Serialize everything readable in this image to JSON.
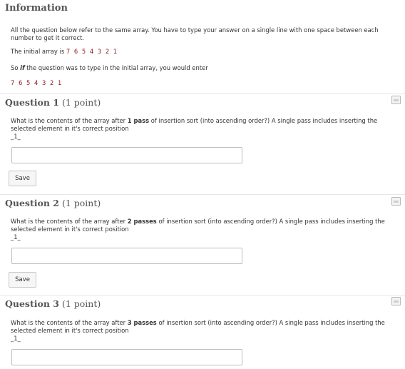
{
  "info": {
    "title": "Information",
    "line1": "All the question below refer to the same array.  You have to type your answer on a single line with one space between each number to get it correct.",
    "initial_prefix": "The initial array is ",
    "initial_array": "7 6 5 4 3 2 1",
    "so_prefix": "So ",
    "so_if": "if",
    "so_suffix": " the question was to type in the initial array, you would enter",
    "example_answer": "7 6 5 4 3 2 1"
  },
  "questions": [
    {
      "label": "Question 1",
      "points": "(1 point)",
      "text_before": "What is the contents of the array after ",
      "text_bold": "1 pass",
      "text_after": " of insertion sort (into ascending order?) A single pass includes inserting the selected element in it's correct position",
      "blank": "_1_",
      "answer_value": "",
      "save_label": "Save"
    },
    {
      "label": "Question 2",
      "points": "(1 point)",
      "text_before": "What is the contents of the array after ",
      "text_bold": "2 passes",
      "text_after": " of insertion sort (into ascending order?) A single pass includes inserting the selected element in it's correct position",
      "blank": "_1_",
      "answer_value": "",
      "save_label": "Save"
    },
    {
      "label": "Question 3",
      "points": "(1 point)",
      "text_before": "What is the contents of the array after ",
      "text_bold": "3 passes",
      "text_after": " of insertion sort (into ascending order?) A single pass includes inserting the selected element in it's correct position",
      "blank": "_1_",
      "answer_value": ""
    }
  ]
}
